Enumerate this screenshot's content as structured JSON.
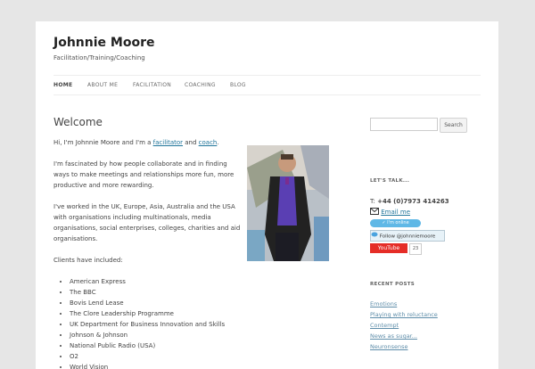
{
  "site": {
    "title": "Johnnie Moore",
    "description": "Facilitation/Training/Coaching"
  },
  "nav": [
    {
      "label": "HOME"
    },
    {
      "label": "ABOUT ME"
    },
    {
      "label": "FACILITATION"
    },
    {
      "label": "COACHING"
    },
    {
      "label": "BLOG"
    }
  ],
  "content": {
    "title": "Welcome",
    "intro_prefix": "Hi, I'm Johnnie Moore and I'm a ",
    "facilitator_link": "facilitator",
    "and_text": " and ",
    "coach_link": "coach",
    "period": ".",
    "p2": "I'm fascinated by how people collaborate and in finding ways to make meetings and relationships more fun, more productive and more rewarding.",
    "p3": "I've worked in the UK, Europe, Asia, Australia and the USA with organisations including multinationals, media organisations, social enterprises, colleges, charities and aid organisations.",
    "clients_heading": "Clients have included:",
    "clients": [
      "American Express",
      "The BBC",
      "Bovis Lend Lease",
      "The Clore Leadership Programme",
      "UK Department for Business Innovation and Skills",
      "Johnson & Johnson",
      "National Public Radio (USA)",
      "O2",
      "World Vision"
    ]
  },
  "sidebar": {
    "search_placeholder": "",
    "search_button": "Search",
    "talk_title": "LET'S TALK...",
    "phone_label": "T:",
    "phone_number": "+44 (0)7973 414263",
    "email_link": "Email me",
    "skype_status": "I'm online",
    "twitter_label": "Follow @johnniemoore",
    "youtube_label": "YouTube",
    "youtube_count": "23",
    "recent_title": "RECENT POSTS",
    "recent_posts": [
      "Emotions",
      "Playing with reluctance",
      "Contempt",
      "News as sugar...",
      "Neuronsense"
    ]
  },
  "colors": {
    "link": "#21759b",
    "youtube": "#e52d27",
    "skype": "#5fb8e6"
  }
}
